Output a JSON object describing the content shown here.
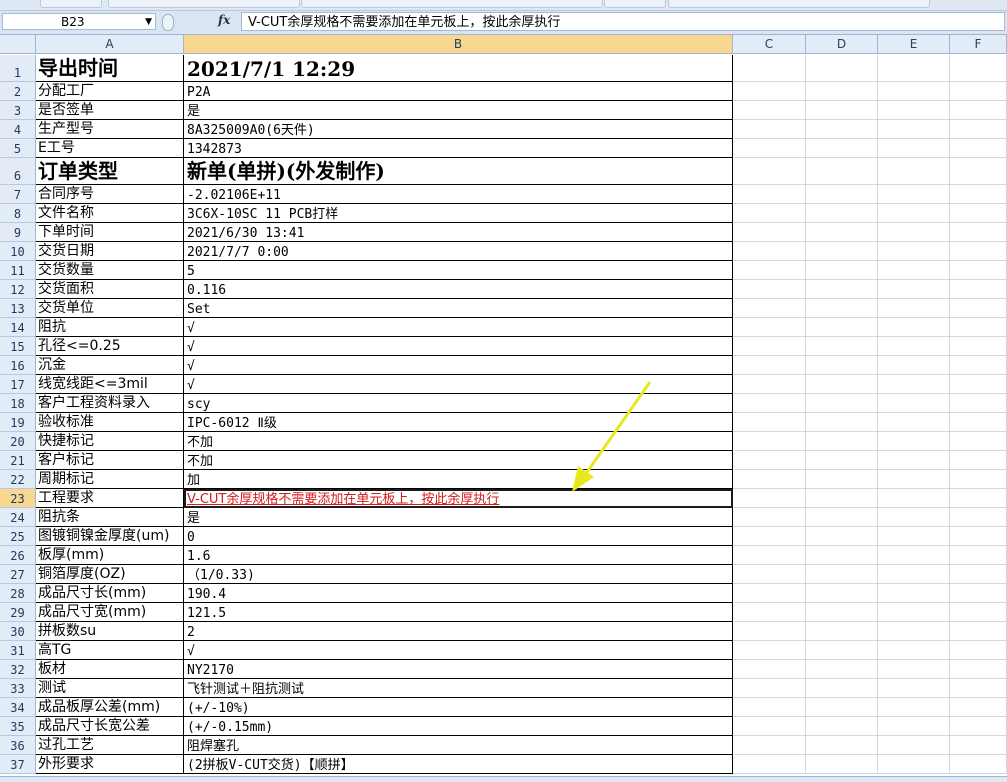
{
  "formula_bar": {
    "name_box": "B23",
    "fx_label": "fx",
    "content": "V-CUT余厚规格不需要添加在单元板上，按此余厚执行"
  },
  "columns": [
    "A",
    "B",
    "C",
    "D",
    "E",
    "F"
  ],
  "rows": [
    {
      "num": "1",
      "a": "导出时间",
      "b": "2021/7/1  12:29",
      "style": "big"
    },
    {
      "num": "2",
      "a": "分配工厂",
      "b": "P2A"
    },
    {
      "num": "3",
      "a": "是否签单",
      "b": "是"
    },
    {
      "num": "4",
      "a": "生产型号",
      "b": "8A325009A0(6天件)"
    },
    {
      "num": "5",
      "a": "E工号",
      "b": "1342873"
    },
    {
      "num": "6",
      "a": "订单类型",
      "b": "新单(单拼)(外发制作)",
      "style": "big"
    },
    {
      "num": "7",
      "a": "合同序号",
      "b": "-2.02106E+11"
    },
    {
      "num": "8",
      "a": "文件名称",
      "b": "3C6X-10SC 11 PCB打样"
    },
    {
      "num": "9",
      "a": "下单时间",
      "b": "2021/6/30 13:41"
    },
    {
      "num": "10",
      "a": "交货日期",
      "b": "2021/7/7 0:00"
    },
    {
      "num": "11",
      "a": "交货数量",
      "b": "5"
    },
    {
      "num": "12",
      "a": "交货面积",
      "b": "0.116"
    },
    {
      "num": "13",
      "a": "交货单位",
      "b": "Set"
    },
    {
      "num": "14",
      "a": "阻抗",
      "b": "√"
    },
    {
      "num": "15",
      "a": "孔径<=0.25",
      "b": "√"
    },
    {
      "num": "16",
      "a": "沉金",
      "b": "√"
    },
    {
      "num": "17",
      "a": "线宽线距<=3mil",
      "b": "√"
    },
    {
      "num": "18",
      "a": "客户工程资料录入",
      "b": "scy"
    },
    {
      "num": "19",
      "a": "验收标准",
      "b": "IPC-6012 Ⅱ级"
    },
    {
      "num": "20",
      "a": "快捷标记",
      "b": "不加"
    },
    {
      "num": "21",
      "a": "客户标记",
      "b": "不加"
    },
    {
      "num": "22",
      "a": "周期标记",
      "b": "加"
    },
    {
      "num": "23",
      "a": "工程要求",
      "b": "V-CUT余厚规格不需要添加在单元板上，按此余厚执行",
      "style": "red",
      "selected": true
    },
    {
      "num": "24",
      "a": "阻抗条",
      "b": "是"
    },
    {
      "num": "25",
      "a": "图镀铜镍金厚度(um)",
      "b": "0"
    },
    {
      "num": "26",
      "a": "板厚(mm)",
      "b": "1.6"
    },
    {
      "num": "27",
      "a": "铜箔厚度(OZ)",
      "b": "（1/0.33)"
    },
    {
      "num": "28",
      "a": "成品尺寸长(mm)",
      "b": "190.4"
    },
    {
      "num": "29",
      "a": "成品尺寸宽(mm)",
      "b": "121.5"
    },
    {
      "num": "30",
      "a": "拼板数su",
      "b": "2"
    },
    {
      "num": "31",
      "a": "高TG",
      "b": "√"
    },
    {
      "num": "32",
      "a": "板材",
      "b": "NY2170"
    },
    {
      "num": "33",
      "a": "测试",
      "b": "飞针测试＋阻抗测试"
    },
    {
      "num": "34",
      "a": "成品板厚公差(mm)",
      "b": "(+/-10%)"
    },
    {
      "num": "35",
      "a": "成品尺寸长宽公差",
      "b": "(+/-0.15mm)"
    },
    {
      "num": "36",
      "a": "过孔工艺",
      "b": "阻焊塞孔"
    },
    {
      "num": "37",
      "a": "外形要求",
      "b": "(2拼板V-CUT交货)【顺拼】"
    }
  ],
  "annotation": {
    "color": "#e8e820",
    "icon": "yellow-arrow-icon"
  }
}
